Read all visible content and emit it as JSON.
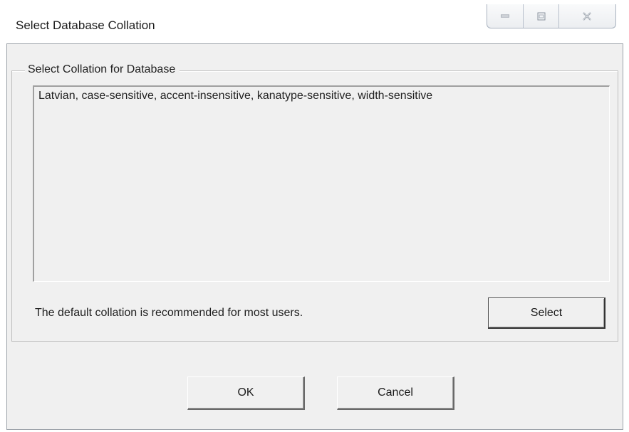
{
  "window": {
    "title": "Select Database Collation",
    "caption_buttons": [
      "minimize-icon",
      "maximize-icon",
      "close-icon"
    ]
  },
  "group": {
    "legend": "Select Collation for Database"
  },
  "collation_list": {
    "items": [
      "Latvian, case-sensitive, accent-insensitive, kanatype-sensitive, width-sensitive"
    ]
  },
  "hint_text": "The default collation is recommended for most users.",
  "buttons": {
    "select": "Select",
    "ok": "OK",
    "cancel": "Cancel"
  },
  "colors": {
    "dialog_background": "#f0f0f0",
    "text": "#1f1f1f"
  }
}
